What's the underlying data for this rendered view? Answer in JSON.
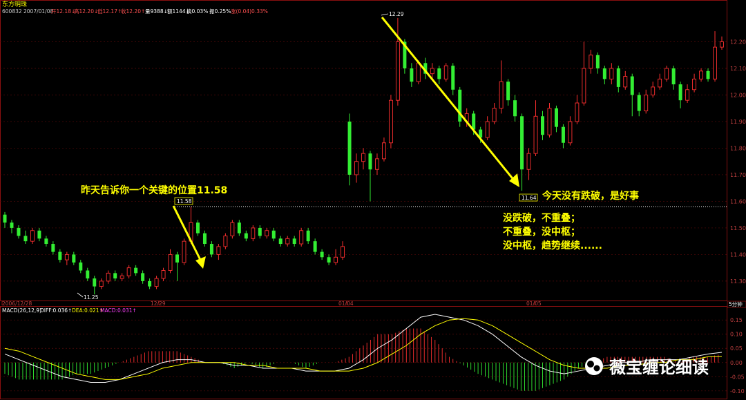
{
  "header": {
    "stock_name": "东方明珠",
    "code_date": "600832 2007/01/08",
    "open": "开12.18↓",
    "high": "高12.20↓",
    "low": "低12.17↑",
    "close": "收12.20↑",
    "volume": "量9388↓",
    "amount": "额1144↓",
    "turnover": "换0.03%",
    "amplitude": "振0.25%",
    "change": "涨(0.04)0.33%"
  },
  "macd_header": {
    "label": "MACD(26,12,9)",
    "diff": "DIFF:0.036↑",
    "dea": "DEA:0.021↑",
    "macd": "MACD:0.031↑"
  },
  "timeframe_button": "5分钟",
  "annotations": {
    "key_level": "昨天告诉你一个关键的位置11.58",
    "not_broken": "今天没有跌破，是好事",
    "line1": "没跌破，不重叠；",
    "line2": "不重叠，没中枢；",
    "line3": "没中枢，趋势继续......"
  },
  "marks": {
    "high_1229": "12.29",
    "low_1125": "11.25",
    "level_1158": "11.58",
    "low_1164": "11.64"
  },
  "watermark": "薇宝缠论细读",
  "colors": {
    "up": "#ff3030",
    "down": "#33ee33",
    "axis": "#c04040",
    "annotation": "#ffff00",
    "dif": "#ffffff",
    "dea": "#ffff00"
  },
  "chart_data": {
    "type": "candlestick",
    "price_axis": {
      "ticks": [
        "12.20",
        "12.10",
        "12.00",
        "11.90",
        "11.80",
        "11.70",
        "11.60",
        "11.50",
        "11.40",
        "11.30"
      ],
      "ylim": [
        11.24,
        12.3
      ]
    },
    "x_ticks": [
      "2006/12/28",
      "12/29",
      "01/04",
      "01/05"
    ],
    "level_line": 11.58,
    "candles": [
      [
        11.55,
        11.52,
        11.56,
        11.5
      ],
      [
        11.52,
        11.5,
        11.53,
        11.48
      ],
      [
        11.5,
        11.47,
        11.51,
        11.46
      ],
      [
        11.47,
        11.45,
        11.49,
        11.44
      ],
      [
        11.45,
        11.49,
        11.5,
        11.44
      ],
      [
        11.49,
        11.46,
        11.5,
        11.45
      ],
      [
        11.46,
        11.44,
        11.47,
        11.43
      ],
      [
        11.44,
        11.41,
        11.45,
        11.4
      ],
      [
        11.41,
        11.38,
        11.42,
        11.37
      ],
      [
        11.38,
        11.4,
        11.41,
        11.36
      ],
      [
        11.4,
        11.37,
        11.41,
        11.36
      ],
      [
        11.37,
        11.34,
        11.38,
        11.33
      ],
      [
        11.34,
        11.31,
        11.35,
        11.3
      ],
      [
        11.31,
        11.28,
        11.32,
        11.25
      ],
      [
        11.28,
        11.3,
        11.31,
        11.27
      ],
      [
        11.3,
        11.33,
        11.34,
        11.29
      ],
      [
        11.33,
        11.31,
        11.34,
        11.3
      ],
      [
        11.31,
        11.32,
        11.33,
        11.3
      ],
      [
        11.32,
        11.35,
        11.36,
        11.31
      ],
      [
        11.35,
        11.33,
        11.36,
        11.32
      ],
      [
        11.33,
        11.3,
        11.34,
        11.29
      ],
      [
        11.3,
        11.28,
        11.31,
        11.27
      ],
      [
        11.28,
        11.31,
        11.32,
        11.27
      ],
      [
        11.31,
        11.34,
        11.35,
        11.3
      ],
      [
        11.34,
        11.4,
        11.42,
        11.33
      ],
      [
        11.4,
        11.37,
        11.41,
        11.3
      ],
      [
        11.37,
        11.45,
        11.46,
        11.36
      ],
      [
        11.45,
        11.52,
        11.58,
        11.44
      ],
      [
        11.52,
        11.48,
        11.53,
        11.47
      ],
      [
        11.48,
        11.44,
        11.49,
        11.43
      ],
      [
        11.44,
        11.4,
        11.45,
        11.39
      ],
      [
        11.4,
        11.43,
        11.44,
        11.38
      ],
      [
        11.43,
        11.47,
        11.48,
        11.42
      ],
      [
        11.47,
        11.52,
        11.53,
        11.46
      ],
      [
        11.52,
        11.48,
        11.53,
        11.47
      ],
      [
        11.48,
        11.46,
        11.49,
        11.45
      ],
      [
        11.46,
        11.5,
        11.51,
        11.45
      ],
      [
        11.5,
        11.47,
        11.51,
        11.46
      ],
      [
        11.47,
        11.49,
        11.5,
        11.46
      ],
      [
        11.49,
        11.46,
        11.5,
        11.45
      ],
      [
        11.46,
        11.44,
        11.47,
        11.43
      ],
      [
        11.44,
        11.46,
        11.47,
        11.43
      ],
      [
        11.46,
        11.44,
        11.47,
        11.43
      ],
      [
        11.44,
        11.49,
        11.5,
        11.43
      ],
      [
        11.49,
        11.45,
        11.5,
        11.44
      ],
      [
        11.45,
        11.41,
        11.46,
        11.4
      ],
      [
        11.41,
        11.39,
        11.42,
        11.38
      ],
      [
        11.39,
        11.37,
        11.4,
        11.36
      ],
      [
        11.37,
        11.39,
        11.42,
        11.36
      ],
      [
        11.39,
        11.43,
        11.45,
        11.38
      ],
      [
        11.9,
        11.7,
        11.93,
        11.66
      ],
      [
        11.7,
        11.75,
        11.78,
        11.67
      ],
      [
        11.75,
        11.78,
        11.8,
        11.72
      ],
      [
        11.78,
        11.72,
        11.79,
        11.6
      ],
      [
        11.72,
        11.76,
        11.78,
        11.7
      ],
      [
        11.76,
        11.82,
        11.84,
        11.75
      ],
      [
        11.82,
        11.98,
        12.0,
        11.8
      ],
      [
        11.98,
        12.2,
        12.29,
        11.96
      ],
      [
        12.2,
        12.1,
        12.21,
        12.08
      ],
      [
        12.1,
        12.05,
        12.12,
        12.03
      ],
      [
        12.05,
        12.12,
        12.13,
        12.04
      ],
      [
        12.12,
        12.08,
        12.14,
        12.06
      ],
      [
        12.08,
        12.1,
        12.12,
        12.06
      ],
      [
        12.1,
        12.06,
        12.11,
        12.04
      ],
      [
        12.06,
        12.11,
        12.12,
        12.05
      ],
      [
        12.11,
        12.02,
        12.12,
        12.0
      ],
      [
        12.02,
        11.9,
        12.03,
        11.88
      ],
      [
        11.9,
        11.93,
        11.95,
        11.88
      ],
      [
        11.93,
        11.87,
        11.94,
        11.85
      ],
      [
        11.87,
        11.84,
        11.88,
        11.82
      ],
      [
        11.84,
        11.9,
        11.92,
        11.83
      ],
      [
        11.9,
        11.95,
        11.97,
        11.89
      ],
      [
        11.95,
        12.05,
        12.13,
        11.93
      ],
      [
        12.05,
        11.98,
        12.06,
        11.96
      ],
      [
        11.98,
        11.92,
        12.0,
        11.9
      ],
      [
        11.92,
        11.72,
        11.93,
        11.64
      ],
      [
        11.72,
        11.78,
        11.8,
        11.68
      ],
      [
        11.78,
        11.92,
        11.98,
        11.77
      ],
      [
        11.92,
        11.85,
        11.94,
        11.83
      ],
      [
        11.85,
        11.95,
        11.97,
        11.84
      ],
      [
        11.95,
        11.88,
        11.96,
        11.86
      ],
      [
        11.88,
        11.82,
        11.89,
        11.8
      ],
      [
        11.82,
        11.9,
        11.92,
        11.81
      ],
      [
        11.9,
        11.97,
        12.0,
        11.89
      ],
      [
        11.97,
        12.1,
        12.2,
        11.96
      ],
      [
        12.1,
        12.15,
        12.17,
        12.08
      ],
      [
        12.15,
        12.1,
        12.16,
        12.08
      ],
      [
        12.1,
        12.06,
        12.11,
        12.04
      ],
      [
        12.06,
        12.1,
        12.12,
        12.04
      ],
      [
        12.1,
        12.03,
        12.11,
        12.01
      ],
      [
        12.03,
        12.07,
        12.09,
        12.02
      ],
      [
        12.07,
        12.0,
        12.08,
        11.92
      ],
      [
        12.0,
        11.94,
        12.01,
        11.92
      ],
      [
        11.94,
        12.0,
        12.02,
        11.93
      ],
      [
        12.0,
        12.03,
        12.05,
        11.99
      ],
      [
        12.03,
        12.06,
        12.08,
        12.02
      ],
      [
        12.06,
        12.1,
        12.11,
        12.05
      ],
      [
        12.1,
        12.04,
        12.11,
        12.02
      ],
      [
        12.04,
        11.98,
        12.05,
        11.95
      ],
      [
        11.98,
        12.02,
        12.04,
        11.97
      ],
      [
        12.02,
        12.06,
        12.08,
        12.01
      ],
      [
        12.06,
        12.09,
        12.1,
        12.05
      ],
      [
        12.09,
        12.06,
        12.1,
        12.05
      ],
      [
        12.06,
        12.18,
        12.24,
        12.05
      ],
      [
        12.18,
        12.2,
        12.22,
        12.17
      ]
    ],
    "macd": {
      "ylim": [
        -0.12,
        0.17
      ],
      "ticks": [
        "0.15",
        "0.10",
        "0.05",
        "0.00",
        "-0.05",
        "-0.10"
      ],
      "dif": [
        0.03,
        0.01,
        -0.01,
        -0.03,
        -0.05,
        -0.06,
        -0.07,
        -0.07,
        -0.06,
        -0.04,
        -0.02,
        0.0,
        0.01,
        0.01,
        0.0,
        0.0,
        -0.01,
        -0.01,
        -0.02,
        -0.02,
        -0.02,
        -0.03,
        -0.03,
        -0.03,
        -0.02,
        0.01,
        0.05,
        0.08,
        0.12,
        0.16,
        0.17,
        0.16,
        0.15,
        0.13,
        0.1,
        0.06,
        0.02,
        -0.01,
        -0.03,
        -0.04,
        -0.03,
        -0.02,
        -0.01,
        0.0,
        0.0,
        0.01,
        0.01,
        0.01,
        0.02,
        0.03,
        0.036
      ],
      "dea": [
        0.05,
        0.04,
        0.02,
        0.0,
        -0.02,
        -0.04,
        -0.05,
        -0.06,
        -0.06,
        -0.05,
        -0.04,
        -0.02,
        -0.01,
        0.0,
        0.0,
        0.0,
        0.0,
        -0.01,
        -0.01,
        -0.02,
        -0.02,
        -0.02,
        -0.03,
        -0.03,
        -0.03,
        -0.02,
        0.0,
        0.03,
        0.06,
        0.1,
        0.13,
        0.15,
        0.155,
        0.15,
        0.13,
        0.1,
        0.07,
        0.04,
        0.01,
        -0.01,
        -0.02,
        -0.02,
        -0.02,
        -0.01,
        -0.01,
        0.0,
        0.0,
        0.01,
        0.01,
        0.02,
        0.021
      ]
    }
  }
}
